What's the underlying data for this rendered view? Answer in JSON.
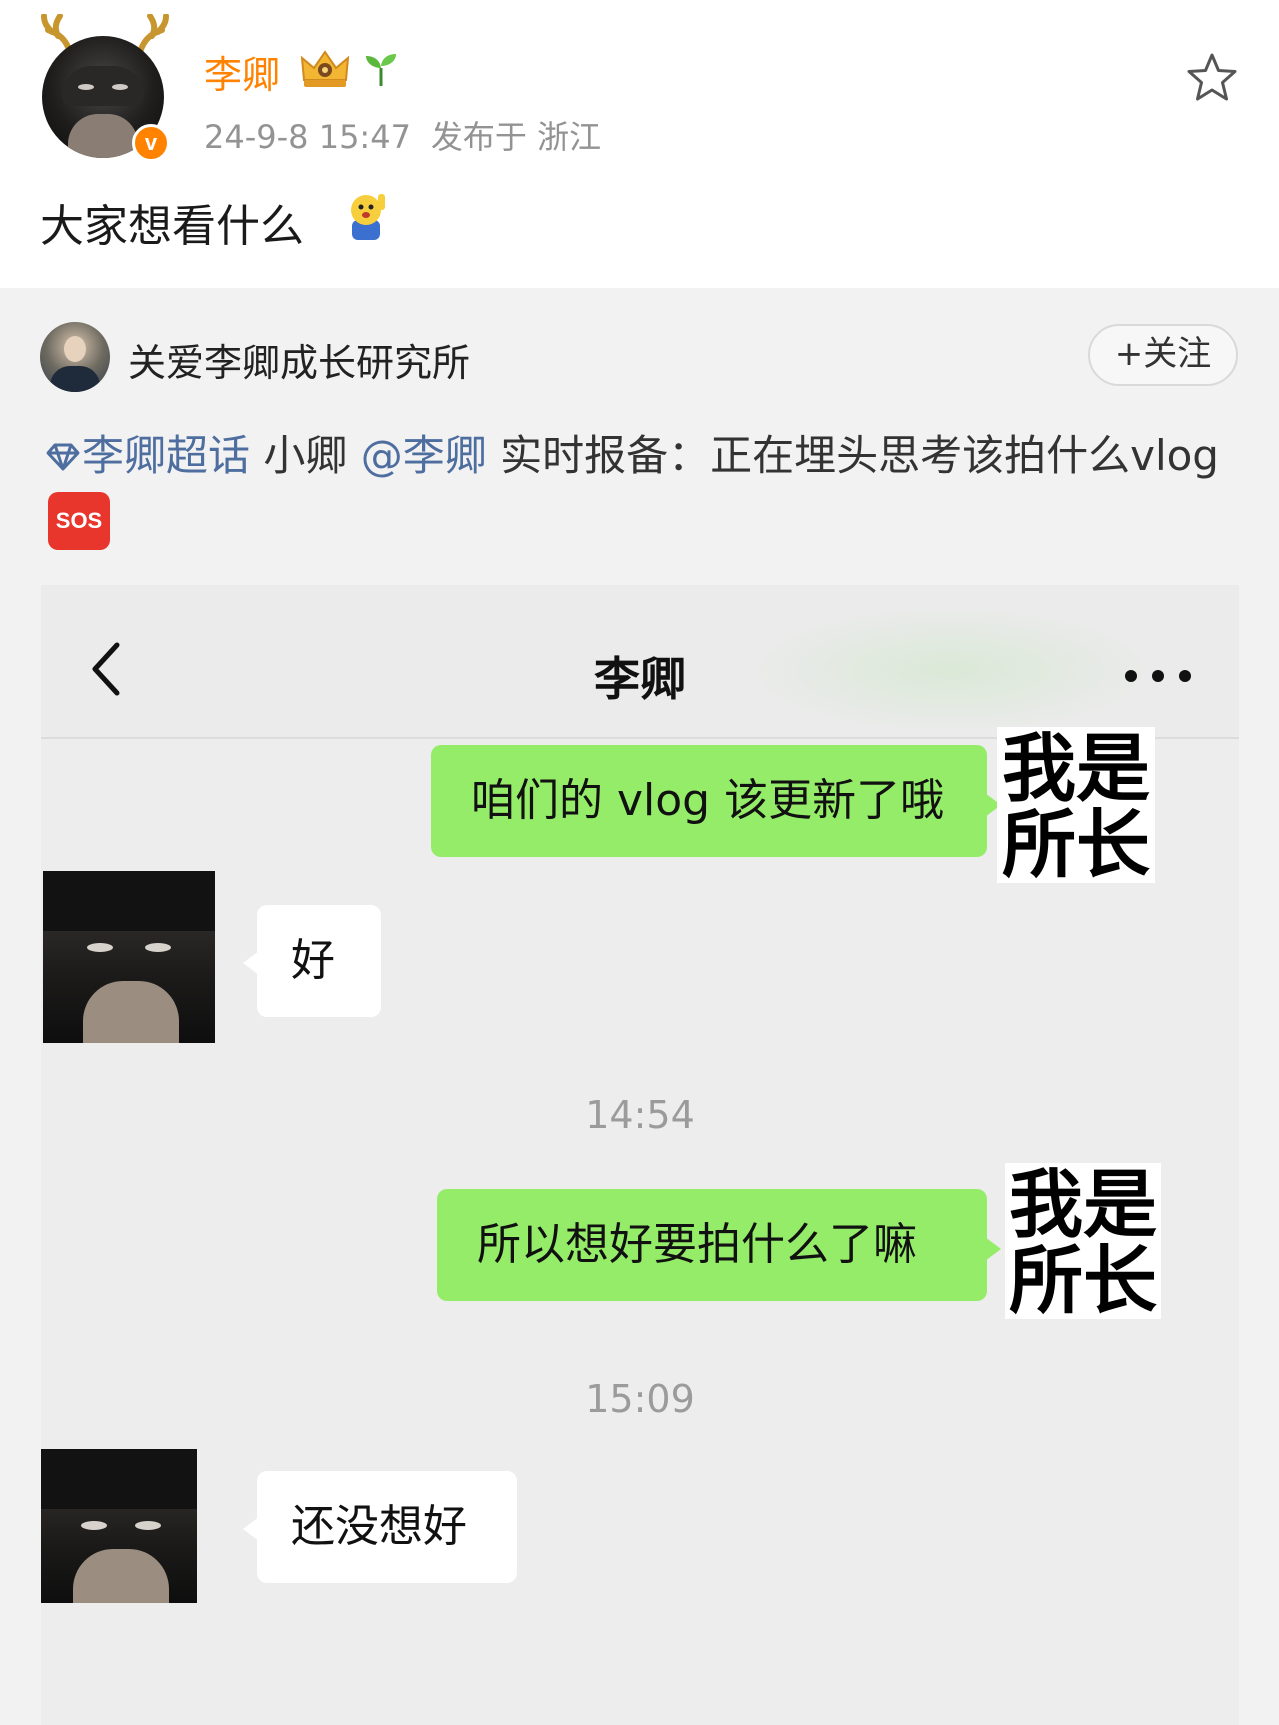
{
  "post": {
    "username": "李卿",
    "timestamp": "24-9-8 15:47",
    "location": "发布于 浙江",
    "text": "大家想看什么",
    "icons": {
      "verified": "v",
      "crown": "crown-icon",
      "sprout": "sprout-icon",
      "favorite": "star-icon",
      "emoji": "waving-emoji"
    }
  },
  "repost": {
    "account_name": "关爱李卿成长研究所",
    "follow_label": "+关注",
    "supertopic": "李卿超话",
    "text_part1": " 小卿 ",
    "mention": "@李卿",
    "text_part2": " 实时报备：正在埋头思考该拍什么vlog",
    "sos_label": "SOS"
  },
  "chat": {
    "title": "李卿",
    "messages": [
      {
        "side": "right",
        "text": "咱们的 vlog 该更新了哦",
        "sticker": [
          "我是",
          "所长"
        ]
      },
      {
        "side": "left",
        "text": "好"
      },
      {
        "type": "time",
        "text": "14:54"
      },
      {
        "side": "right",
        "text": "所以想好要拍什么了嘛",
        "sticker": [
          "我是",
          "所长"
        ]
      },
      {
        "type": "time",
        "text": "15:09"
      },
      {
        "side": "left",
        "text": "还没想好"
      }
    ]
  },
  "colors": {
    "brand_orange": "#ff8200",
    "link_blue": "#4e6ea0",
    "bubble_green": "#95ec69",
    "chat_bg": "#ededed",
    "sos_red": "#e8362d"
  }
}
